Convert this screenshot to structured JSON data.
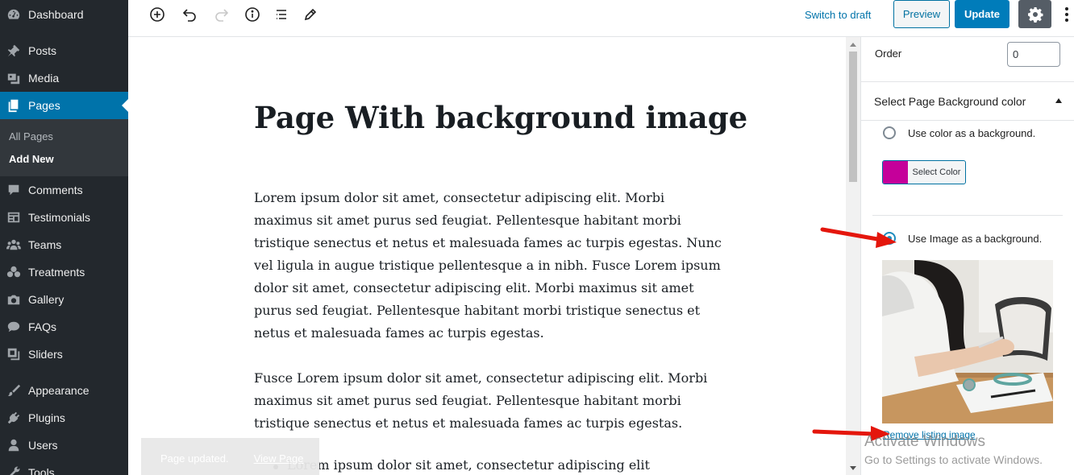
{
  "sidebar": {
    "items": [
      {
        "label": "Dashboard",
        "icon": "dashboard-icon"
      },
      {
        "label": "Posts",
        "icon": "pin-icon"
      },
      {
        "label": "Media",
        "icon": "media-icon"
      },
      {
        "label": "Pages",
        "icon": "pages-icon"
      },
      {
        "label": "Comments",
        "icon": "comment-icon"
      },
      {
        "label": "Testimonials",
        "icon": "testimonial-icon"
      },
      {
        "label": "Teams",
        "icon": "group-icon"
      },
      {
        "label": "Treatments",
        "icon": "treatment-icon"
      },
      {
        "label": "Gallery",
        "icon": "camera-icon"
      },
      {
        "label": "FAQs",
        "icon": "faq-icon"
      },
      {
        "label": "Sliders",
        "icon": "slides-icon"
      },
      {
        "label": "Appearance",
        "icon": "brush-icon"
      },
      {
        "label": "Plugins",
        "icon": "plug-icon"
      },
      {
        "label": "Users",
        "icon": "user-icon"
      },
      {
        "label": "Tools",
        "icon": "wrench-icon"
      }
    ],
    "submenu": [
      "All Pages",
      "Add New"
    ],
    "accent_color": "#0073aa"
  },
  "toolbar": {
    "switch_to_draft": "Switch to draft",
    "preview": "Preview",
    "update": "Update"
  },
  "editor": {
    "title": "Page With background image",
    "paragraphs": [
      "Lorem ipsum dolor sit amet, consectetur adipiscing elit. Morbi maximus sit amet purus sed feugiat. Pellentesque habitant morbi tristique senectus et netus et malesuada fames ac turpis egestas. Nunc vel ligula in augue tristique pellentesque a in nibh. Fusce Lorem ipsum dolor sit amet, consectetur adipiscing elit. Morbi maximus sit amet purus sed feugiat. Pellentesque habitant morbi tristique senectus et netus et malesuada fames ac turpis egestas.",
      "Fusce Lorem ipsum dolor sit amet, consectetur adipiscing elit. Morbi maximus sit amet purus sed feugiat. Pellentesque habitant morbi tristique senectus et netus et malesuada fames ac turpis egestas."
    ],
    "list_item": "Lorem ipsum dolor sit amet, consectetur adipiscing elit",
    "snackbar": {
      "text": "Page updated.",
      "link": "View Page"
    }
  },
  "panel": {
    "order_label": "Order",
    "order_value": "0",
    "bg_section_title": "Select Page Background color",
    "option_color": "Use color as a background.",
    "select_color_label": "Select Color",
    "selected_color": "#c5009a",
    "option_image": "Use Image as a background.",
    "selected_option": "image",
    "remove_image_label": "Remove listing image"
  },
  "watermark": {
    "line1": "Activate Windows",
    "line2": "Go to Settings to activate Windows."
  }
}
